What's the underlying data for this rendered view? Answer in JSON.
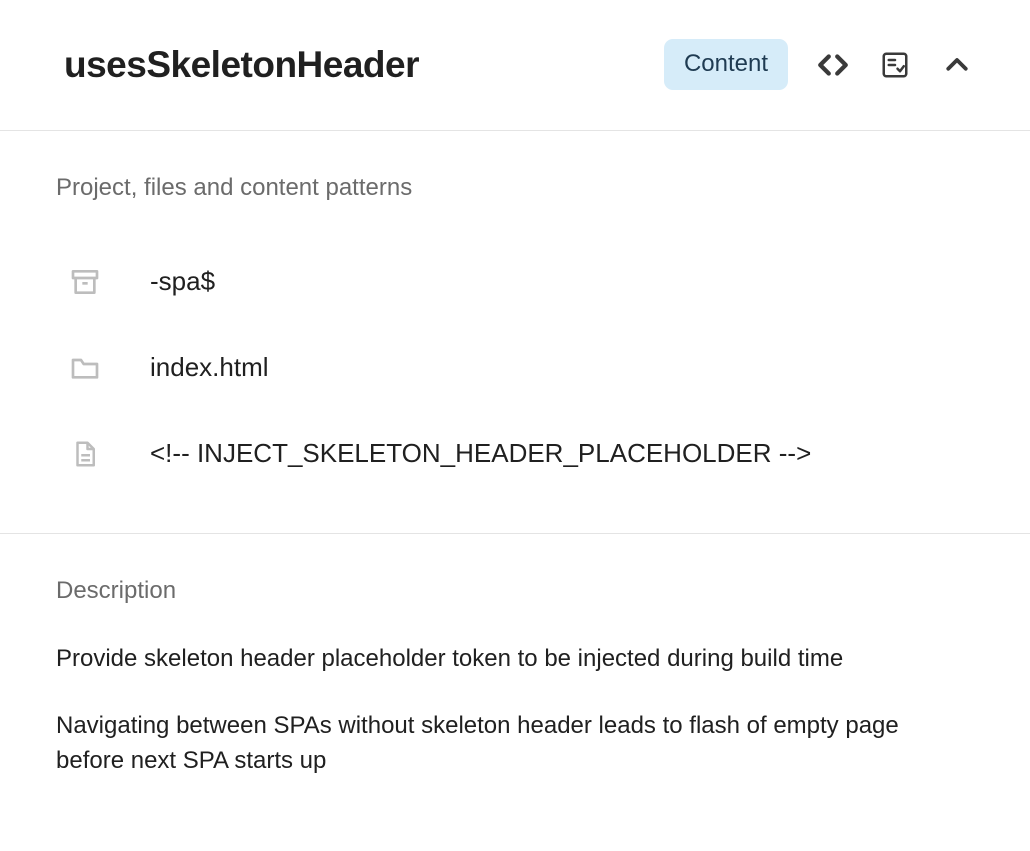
{
  "header": {
    "title": "usesSkeletonHeader",
    "chip_label": "Content"
  },
  "patternsSection": {
    "label": "Project, files and content patterns",
    "rows": [
      {
        "icon": "archive-icon",
        "text": "-spa$"
      },
      {
        "icon": "folder-icon",
        "text": "index.html"
      },
      {
        "icon": "file-icon",
        "text": "<!-- INJECT_SKELETON_HEADER_PLACEHOLDER -->"
      }
    ]
  },
  "description": {
    "label": "Description",
    "paragraphs": [
      "Provide skeleton header placeholder token to be injected during build time",
      "Navigating between SPAs without skeleton header leads to flash of empty page before next SPA starts up"
    ]
  }
}
